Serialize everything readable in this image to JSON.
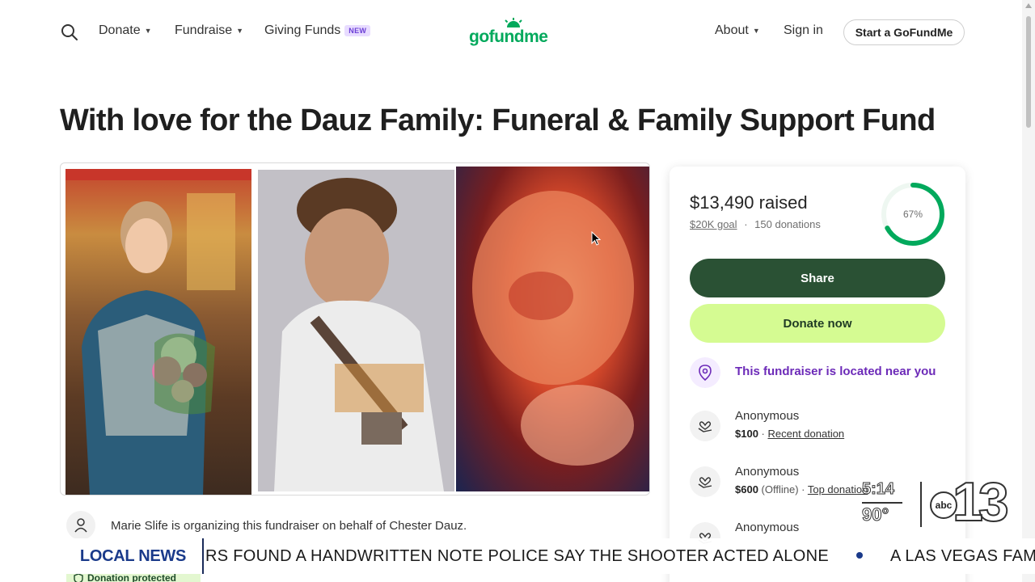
{
  "nav": {
    "links": [
      {
        "label": "Donate"
      },
      {
        "label": "Fundraise"
      },
      {
        "label": "Giving Funds",
        "badge": "NEW"
      },
      {
        "label": "About"
      },
      {
        "label": "Sign in"
      }
    ],
    "logo": "gofundme",
    "cta": "Start a GoFundMe"
  },
  "campaign": {
    "title": "With love for the Dauz Family: Funeral & Family Support Fund",
    "organizer_text": "Marie Slife is organizing this fundraiser on behalf of Chester Dauz.",
    "protected_label": "Donation protected"
  },
  "sidebar": {
    "raised": "$13,490 raised",
    "goal": "$20K goal",
    "separator": "·",
    "donations": "150 donations",
    "percent_label": "67%",
    "percent": 0.67,
    "share_label": "Share",
    "donate_label": "Donate now",
    "location_text": "This fundraiser is located near you",
    "donors": [
      {
        "name": "Anonymous",
        "amount": "$100",
        "detail": " · ",
        "tag": "Recent donation"
      },
      {
        "name": "Anonymous",
        "amount": "$600",
        "detail": " (Offline) · ",
        "tag": "Top donation"
      },
      {
        "name": "Anonymous",
        "amount": "",
        "detail": "",
        "tag": ""
      }
    ]
  },
  "overlay": {
    "section": "LOCAL NEWS",
    "ticker_1": "RS FOUND A HANDWRITTEN NOTE POLICE SAY THE SHOOTER ACTED ALONE",
    "ticker_2": "A LAS VEGAS FAMI",
    "time": "5:14",
    "temp": "90°",
    "network": "abc",
    "channel": "13"
  },
  "colors": {
    "brand_green": "#02a95c",
    "share_bg": "#2a5134",
    "donate_bg": "#d5fb92",
    "location_purple": "#6c2ab8",
    "ring_green": "#02a95c"
  },
  "icons": [
    "search-icon",
    "location-pin-icon",
    "heart-hand-icon",
    "user-icon",
    "shield-icon"
  ]
}
